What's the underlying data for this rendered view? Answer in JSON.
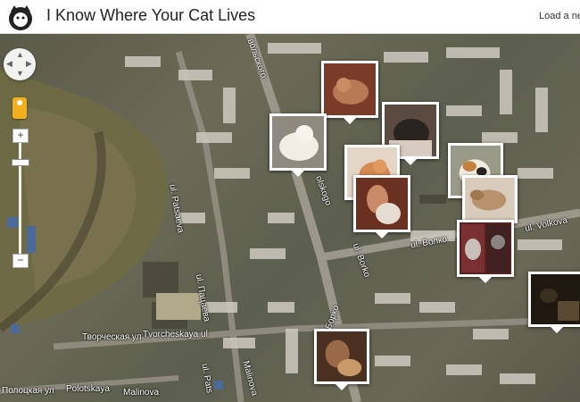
{
  "header": {
    "title": "I Know Where Your Cat Lives",
    "load_link": "Load a ne"
  },
  "map": {
    "street_labels": [
      "Tvorcheskaya ul",
      "Творческая ул",
      "ul. Volkova",
      "ul. Волко",
      "ul. Borko",
      "ul. Борко",
      "ul. Patsaeva",
      "ul. Пацаева",
      "ul. Pats",
      "olskogo",
      "вольского",
      "Polotskaya",
      "Полоцкая ул",
      "Malinova",
      "Malinova"
    ]
  },
  "controls": {
    "zoom_in": "+",
    "zoom_out": "−",
    "pan_icons": [
      "▲",
      "▼",
      "◀",
      "▶"
    ]
  },
  "markers": [
    {
      "theme": "orange-cat-lying",
      "color": "#7a3b28"
    },
    {
      "theme": "white-fluffy-cat",
      "color": "#d9cfc4"
    },
    {
      "theme": "dark-cat-on-pillow",
      "color": "#3a2f2a"
    },
    {
      "theme": "ginger-cat",
      "color": "#c9794a"
    },
    {
      "theme": "person-holding-cat",
      "color": "#8a4a2e"
    },
    {
      "theme": "calico-cat",
      "color": "#b58a5a"
    },
    {
      "theme": "cat-sleeping",
      "color": "#c2a88c"
    },
    {
      "theme": "cats-collage",
      "color": "#6b2a2a"
    },
    {
      "theme": "dark-cat-window",
      "color": "#2a2318"
    },
    {
      "theme": "person-selfie-cat",
      "color": "#5a3a22"
    }
  ]
}
